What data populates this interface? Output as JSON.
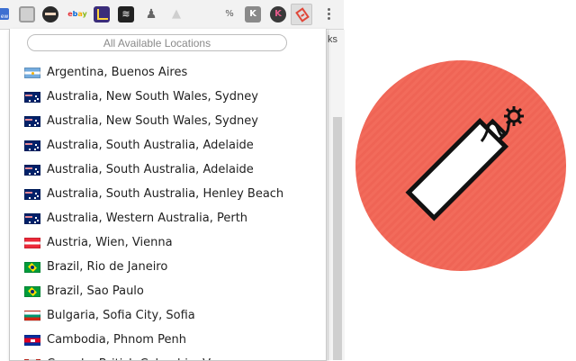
{
  "toolbar": {
    "extensions": [
      {
        "name": "new-badge-icon",
        "label": "ew"
      },
      {
        "name": "window-icon"
      },
      {
        "name": "ninja-icon"
      },
      {
        "name": "ebay-icon",
        "parts": [
          "e",
          "b",
          "a",
          "y"
        ]
      },
      {
        "name": "chart-icon"
      },
      {
        "name": "stack-icon",
        "label": "≋"
      },
      {
        "name": "person-icon",
        "label": "♟"
      },
      {
        "name": "triangle-icon",
        "label": "▲"
      },
      {
        "name": "percent-icon",
        "label": "%"
      },
      {
        "name": "k-icon",
        "label": "K"
      },
      {
        "name": "k-circle-icon",
        "label": "K"
      },
      {
        "name": "dynamite-icon"
      }
    ]
  },
  "page": {
    "partial_text": "ks"
  },
  "popup": {
    "search_placeholder": "All Available Locations",
    "locations": [
      {
        "label": "Argentina, Buenos Aires",
        "flag": "ar"
      },
      {
        "label": "Australia, New South Wales, Sydney",
        "flag": "au"
      },
      {
        "label": "Australia, New South Wales, Sydney",
        "flag": "au"
      },
      {
        "label": "Australia, South Australia, Adelaide",
        "flag": "au"
      },
      {
        "label": "Australia, South Australia, Adelaide",
        "flag": "au"
      },
      {
        "label": "Australia, South Australia, Henley Beach",
        "flag": "au"
      },
      {
        "label": "Australia, Western Australia, Perth",
        "flag": "au"
      },
      {
        "label": "Austria, Wien, Vienna",
        "flag": "at"
      },
      {
        "label": "Brazil, Rio de Janeiro",
        "flag": "br"
      },
      {
        "label": "Brazil, Sao Paulo",
        "flag": "br"
      },
      {
        "label": "Bulgaria, Sofia City, Sofia",
        "flag": "bg"
      },
      {
        "label": "Cambodia, Phnom Penh",
        "flag": "kh"
      },
      {
        "label": "Canada, British Columbia, Vancouver",
        "flag": "ca"
      }
    ]
  },
  "logo": {
    "name": "dynamite-logo",
    "circle_color": "#f26b5b",
    "stick_fill": "#ffffff",
    "outline_color": "#111111"
  }
}
